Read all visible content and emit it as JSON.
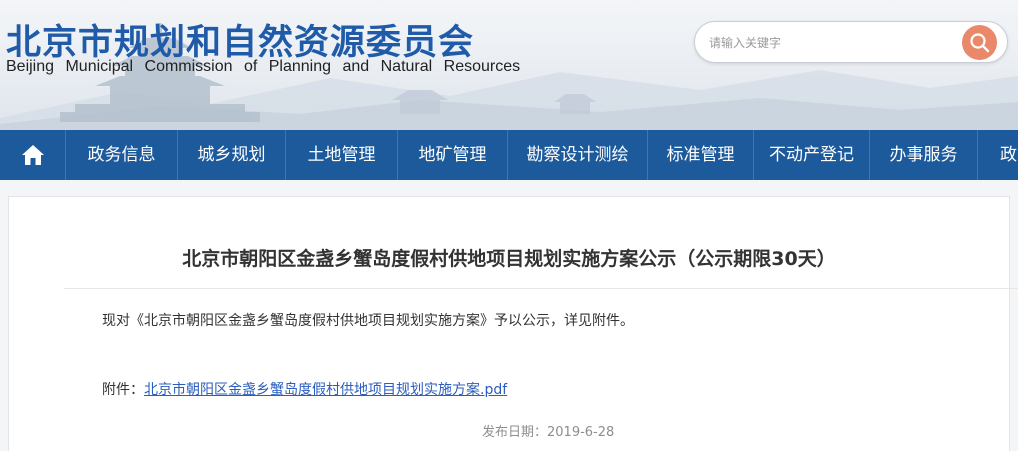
{
  "header": {
    "title": "北京市规划和自然资源委员会",
    "subtitle": "Beijing Municipal Commission of Planning and Natural Resources",
    "search": {
      "placeholder": "请输入关键字",
      "button_icon": "search-icon"
    }
  },
  "nav": {
    "home_icon": "home-icon",
    "items": [
      {
        "label": "政务信息"
      },
      {
        "label": "城乡规划"
      },
      {
        "label": "土地管理"
      },
      {
        "label": "地矿管理"
      },
      {
        "label": "勘察设计测绘"
      },
      {
        "label": "标准管理"
      },
      {
        "label": "不动产登记"
      },
      {
        "label": "办事服务"
      },
      {
        "label": "政"
      }
    ]
  },
  "article": {
    "title": "北京市朝阳区金盏乡蟹岛度假村供地项目规划实施方案公示（公示期限30天）",
    "body": "现对《北京市朝阳区金盏乡蟹岛度假村供地项目规划实施方案》予以公示，详见附件。",
    "attachment_label": "附件：",
    "attachment_link": "北京市朝阳区金盏乡蟹岛度假村供地项目规划实施方案.pdf",
    "publish_date": "发布日期：2019-6-28"
  },
  "colors": {
    "brand_blue": "#1f5ba8",
    "nav_bg": "#1c5a9c",
    "search_button": "#e9896a",
    "link": "#2a5dbd"
  }
}
